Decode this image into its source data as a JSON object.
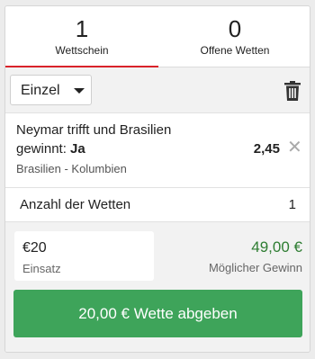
{
  "tabs": [
    {
      "count": "1",
      "label": "Wettschein",
      "active": true
    },
    {
      "count": "0",
      "label": "Offene Wetten",
      "active": false
    }
  ],
  "toolbar": {
    "bet_type": "Einzel",
    "caret_icon": "caret-down-icon",
    "trash_icon": "trash-icon"
  },
  "bet": {
    "selection_line1": "Neymar trifft und Brasilien",
    "selection_prefix": "gewinnt: ",
    "selection_pick": "Ja",
    "match": "Brasilien - Kolumbien",
    "odds": "2,45",
    "remove_glyph": "✕"
  },
  "summary": {
    "count_label": "Anzahl der Wetten",
    "count_value": "1"
  },
  "stake": {
    "amount": "€20",
    "label": "Einsatz",
    "potential_win": "49,00 €",
    "potential_win_label": "Möglicher Gewinn"
  },
  "submit": {
    "label": "20,00 € Wette abgeben"
  },
  "colors": {
    "accent_red": "#d9222a",
    "submit_green": "#3ea45a",
    "win_green": "#2e7d32"
  }
}
